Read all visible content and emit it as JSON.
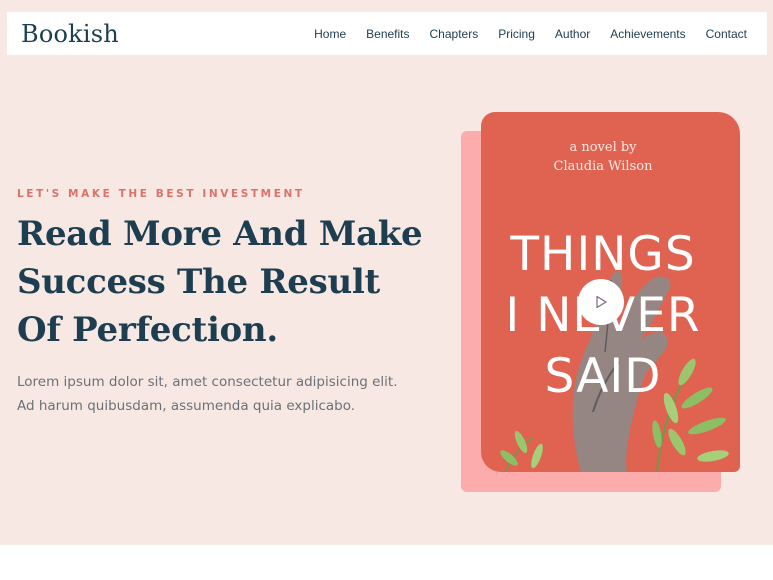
{
  "header": {
    "logo": "Bookish",
    "nav": [
      "Home",
      "Benefits",
      "Chapters",
      "Pricing",
      "Author",
      "Achievements",
      "Contact"
    ]
  },
  "hero": {
    "eyebrow": "LET'S MAKE THE BEST INVESTMENT",
    "headline_lines": [
      "Read More And Make",
      "Success The Result",
      "Of Perfection."
    ],
    "lede_lines": [
      "Lorem ipsum dolor sit, amet consectetur adipisicing elit.",
      "Ad harum quibusdam, assumenda quia explicabo."
    ]
  },
  "book": {
    "byline_lines": [
      "a novel by",
      "Claudia Wilson"
    ],
    "title_lines": [
      "THINGS",
      "I NEVER",
      "SAID"
    ]
  },
  "icons": {
    "play": "play-icon"
  },
  "colors": {
    "hero_bg": "#f7e8e3",
    "navy": "#1d3e50",
    "eyebrow": "#d9736b",
    "book_cover": "#e06352",
    "book_shadow": "#fdacae",
    "leaf_green": "#8cbf63"
  }
}
